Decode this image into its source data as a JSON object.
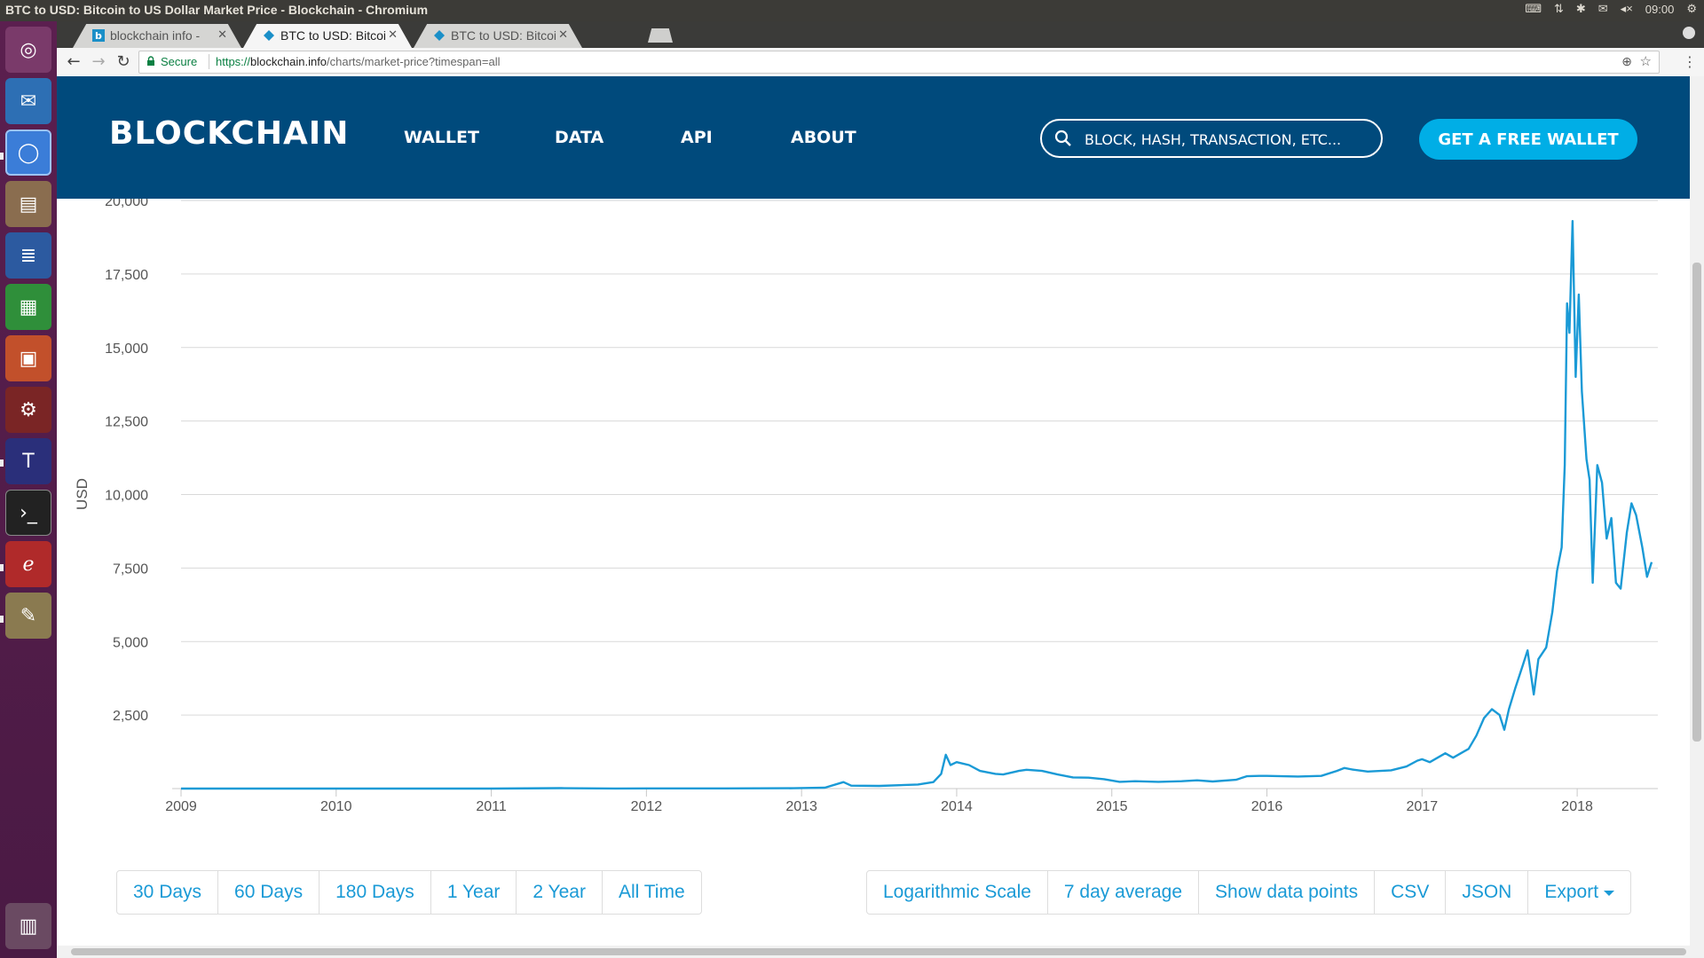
{
  "window": {
    "title": "BTC to USD: Bitcoin to US Dollar Market Price - Blockchain - Chromium"
  },
  "tray": {
    "time": "09:00"
  },
  "tabs": [
    {
      "label": "blockchain info - ",
      "active": false
    },
    {
      "label": "BTC to USD: Bitcoin",
      "active": true
    },
    {
      "label": "BTC to USD: Bitcoin",
      "active": false
    }
  ],
  "omnibox": {
    "secure_label": "Secure",
    "url_scheme": "https://",
    "url_host": "blockchain.info",
    "url_path": "/charts/market-price?timespan=all"
  },
  "site": {
    "logo": "BLOCKCHAIN",
    "nav": [
      "WALLET",
      "DATA",
      "API",
      "ABOUT"
    ],
    "search_placeholder": "BLOCK, HASH, TRANSACTION, ETC...",
    "cta": "GET A FREE WALLET"
  },
  "colors": {
    "header_bg": "#004a7c",
    "accent": "#00aee6",
    "line": "#1a9ad6",
    "link": "#1a9ad6"
  },
  "chart_data": {
    "type": "line",
    "ylabel": "USD",
    "ylim": [
      0,
      20000
    ],
    "yticks": [
      {
        "v": 20000,
        "label": "20,000"
      },
      {
        "v": 17500,
        "label": "17,500"
      },
      {
        "v": 15000,
        "label": "15,000"
      },
      {
        "v": 12500,
        "label": "12,500"
      },
      {
        "v": 10000,
        "label": "10,000"
      },
      {
        "v": 7500,
        "label": "7,500"
      },
      {
        "v": 5000,
        "label": "5,000"
      },
      {
        "v": 2500,
        "label": "2,500"
      }
    ],
    "xlim": [
      2009.0,
      2018.52
    ],
    "xticks": [
      {
        "v": 2009,
        "label": "2009"
      },
      {
        "v": 2010,
        "label": "2010"
      },
      {
        "v": 2011,
        "label": "2011"
      },
      {
        "v": 2012,
        "label": "2012"
      },
      {
        "v": 2013,
        "label": "2013"
      },
      {
        "v": 2014,
        "label": "2014"
      },
      {
        "v": 2015,
        "label": "2015"
      },
      {
        "v": 2016,
        "label": "2016"
      },
      {
        "v": 2017,
        "label": "2017"
      },
      {
        "v": 2018,
        "label": "2018"
      }
    ],
    "grid": true,
    "series": [
      {
        "points": [
          [
            2009.0,
            0
          ],
          [
            2010.0,
            0
          ],
          [
            2010.5,
            0.1
          ],
          [
            2011.0,
            0.3
          ],
          [
            2011.45,
            15
          ],
          [
            2011.8,
            3
          ],
          [
            2012.0,
            5
          ],
          [
            2012.5,
            7
          ],
          [
            2012.95,
            13
          ],
          [
            2013.15,
            30
          ],
          [
            2013.27,
            220
          ],
          [
            2013.32,
            100
          ],
          [
            2013.5,
            90
          ],
          [
            2013.75,
            140
          ],
          [
            2013.85,
            220
          ],
          [
            2013.9,
            500
          ],
          [
            2013.93,
            1150
          ],
          [
            2013.96,
            800
          ],
          [
            2014.0,
            900
          ],
          [
            2014.08,
            800
          ],
          [
            2014.15,
            600
          ],
          [
            2014.25,
            500
          ],
          [
            2014.3,
            480
          ],
          [
            2014.4,
            600
          ],
          [
            2014.45,
            640
          ],
          [
            2014.55,
            600
          ],
          [
            2014.65,
            480
          ],
          [
            2014.75,
            380
          ],
          [
            2014.85,
            370
          ],
          [
            2014.95,
            320
          ],
          [
            2015.05,
            230
          ],
          [
            2015.15,
            250
          ],
          [
            2015.3,
            230
          ],
          [
            2015.45,
            250
          ],
          [
            2015.55,
            280
          ],
          [
            2015.65,
            240
          ],
          [
            2015.8,
            300
          ],
          [
            2015.87,
            420
          ],
          [
            2015.95,
            430
          ],
          [
            2016.0,
            430
          ],
          [
            2016.2,
            410
          ],
          [
            2016.35,
            430
          ],
          [
            2016.45,
            600
          ],
          [
            2016.5,
            700
          ],
          [
            2016.55,
            650
          ],
          [
            2016.65,
            580
          ],
          [
            2016.8,
            620
          ],
          [
            2016.9,
            750
          ],
          [
            2016.97,
            950
          ],
          [
            2017.0,
            1000
          ],
          [
            2017.05,
            900
          ],
          [
            2017.1,
            1050
          ],
          [
            2017.15,
            1200
          ],
          [
            2017.2,
            1050
          ],
          [
            2017.25,
            1200
          ],
          [
            2017.3,
            1350
          ],
          [
            2017.35,
            1800
          ],
          [
            2017.4,
            2400
          ],
          [
            2017.45,
            2700
          ],
          [
            2017.5,
            2500
          ],
          [
            2017.53,
            2000
          ],
          [
            2017.56,
            2700
          ],
          [
            2017.6,
            3400
          ],
          [
            2017.65,
            4200
          ],
          [
            2017.68,
            4700
          ],
          [
            2017.72,
            3200
          ],
          [
            2017.75,
            4400
          ],
          [
            2017.8,
            4800
          ],
          [
            2017.84,
            6000
          ],
          [
            2017.87,
            7400
          ],
          [
            2017.9,
            8200
          ],
          [
            2017.92,
            11000
          ],
          [
            2017.935,
            16500
          ],
          [
            2017.95,
            15500
          ],
          [
            2017.97,
            19300
          ],
          [
            2017.99,
            14000
          ],
          [
            2018.01,
            16800
          ],
          [
            2018.03,
            13500
          ],
          [
            2018.06,
            11200
          ],
          [
            2018.08,
            10500
          ],
          [
            2018.1,
            7000
          ],
          [
            2018.13,
            11000
          ],
          [
            2018.16,
            10400
          ],
          [
            2018.19,
            8500
          ],
          [
            2018.22,
            9200
          ],
          [
            2018.25,
            7000
          ],
          [
            2018.28,
            6800
          ],
          [
            2018.32,
            8700
          ],
          [
            2018.35,
            9700
          ],
          [
            2018.38,
            9300
          ],
          [
            2018.42,
            8200
          ],
          [
            2018.45,
            7200
          ],
          [
            2018.48,
            7700
          ]
        ]
      }
    ]
  },
  "range_buttons": [
    "30 Days",
    "60 Days",
    "180 Days",
    "1 Year",
    "2 Year",
    "All Time"
  ],
  "option_buttons": [
    "Logarithmic Scale",
    "7 day average",
    "Show data points",
    "CSV",
    "JSON"
  ],
  "export_button": "Export"
}
